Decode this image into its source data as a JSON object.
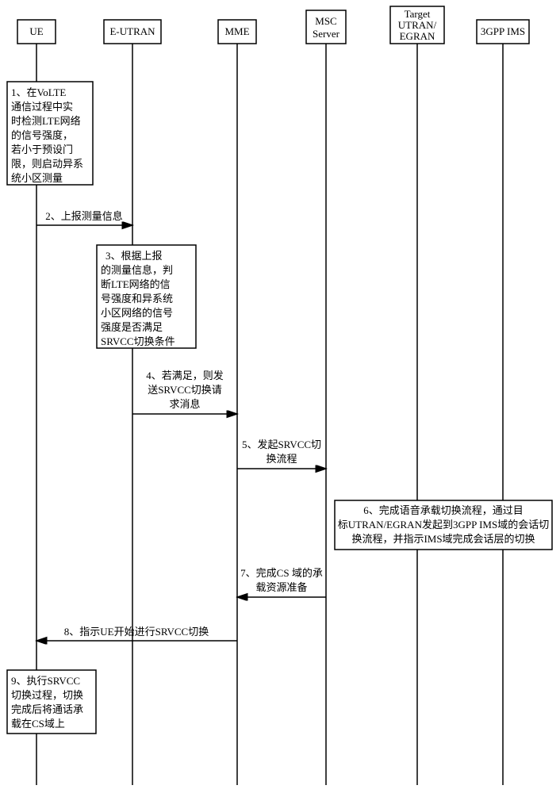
{
  "actors": {
    "ue": "UE",
    "eutran": "E-UTRAN",
    "mme": "MME",
    "msc": [
      "MSC",
      "Server"
    ],
    "target": [
      "Target",
      "UTRAN/",
      "EGRAN"
    ],
    "ims": "3GPP IMS"
  },
  "events": {
    "e1": [
      "1、在VoLTE",
      "通信过程中实",
      "时检测LTE网络",
      "的信号强度，",
      "若小于预设门",
      "限，则启动异系",
      "统小区测量"
    ],
    "e2": "2、上报测量信息",
    "e3": [
      "3、根据上报",
      "的测量信息，判",
      "断LTE网络的信",
      "号强度和异系统",
      "小区网络的信号",
      "强度是否满足",
      "SRVCC切换条件"
    ],
    "e4": [
      "4、若满足，则发",
      "送SRVCC切换请",
      "求消息"
    ],
    "e5": [
      "5、发起SRVCC切",
      "换流程"
    ],
    "e6": [
      "6、完成语音承载切换流程，通过目",
      "标UTRAN/EGRAN发起到3GPP IMS域的会话切",
      "换流程，并指示IMS域完成会话层的切换"
    ],
    "e7": [
      "7、完成CS 域的承",
      "载资源准备"
    ],
    "e8": "8、指示UE开始进行SRVCC切换",
    "e9": [
      "9、执行SRVCC",
      "切换过程，切换",
      "完成后将通话承",
      "载在CS域上"
    ]
  }
}
